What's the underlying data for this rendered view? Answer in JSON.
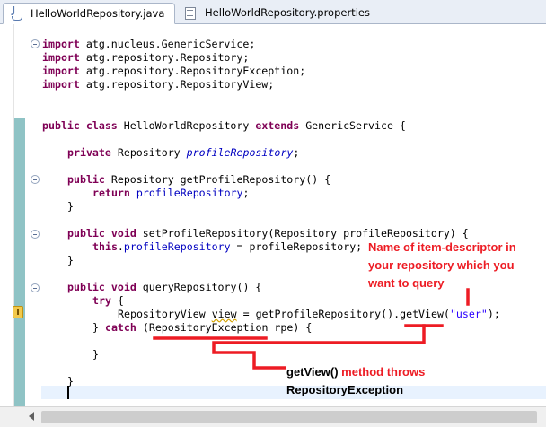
{
  "tabs": [
    {
      "label": "HelloWorldRepository.java",
      "icon": "java-file-icon",
      "active": true
    },
    {
      "label": "HelloWorldRepository.properties",
      "icon": "properties-file-icon",
      "active": false
    }
  ],
  "code_lines": {
    "l1": {
      "kw": "import",
      "rest": " atg.nucleus.GenericService;"
    },
    "l2": {
      "kw": "import",
      "rest": " atg.repository.Repository;"
    },
    "l3": {
      "kw": "import",
      "rest": " atg.repository.RepositoryException;"
    },
    "l4": {
      "kw": "import",
      "rest": " atg.repository.RepositoryView;"
    },
    "l5": {
      "kw1": "public",
      "kw2": "class",
      "name": " HelloWorldRepository ",
      "kw3": "extends",
      "rest": " GenericService {"
    },
    "l6": {
      "kw": "private",
      "type": " Repository ",
      "field": "profileRepository",
      "end": ";"
    },
    "l7": {
      "kw": "public",
      "rest": " Repository getProfileRepository() {"
    },
    "l8": {
      "kw": "return",
      "field": " profileRepository",
      "end": ";"
    },
    "l9": {
      "text": "}"
    },
    "l10": {
      "kw1": "public",
      "kw2": "void",
      "rest": " setProfileRepository(Repository profileRepository) {"
    },
    "l11": {
      "kw": "this",
      "dot": ".",
      "field": "profileRepository",
      "rest": " = profileRepository;"
    },
    "l12": {
      "text": "}"
    },
    "l13": {
      "kw1": "public",
      "kw2": "void",
      "rest": " queryRepository() {"
    },
    "l14": {
      "kw": "try",
      "rest": " {"
    },
    "l15": {
      "pre": "RepositoryView ",
      "warn": "view",
      "mid": " = getProfileRepository().getView(",
      "str": "\"user\"",
      "end": ");"
    },
    "l16": {
      "pre": "} ",
      "kw": "catch",
      "rest": " (RepositoryException rpe) {"
    },
    "l17": {
      "text": "}"
    },
    "l18": {
      "text": "}"
    }
  },
  "annotations": {
    "descriptor_note": [
      "Name of item-descriptor in",
      "your repository which you",
      "want to query"
    ],
    "throws_method": "getView()",
    "throws_text": " method throws",
    "throws_exception": "RepositoryException",
    "color_red": "#ed1c24",
    "color_black": "#000000"
  }
}
